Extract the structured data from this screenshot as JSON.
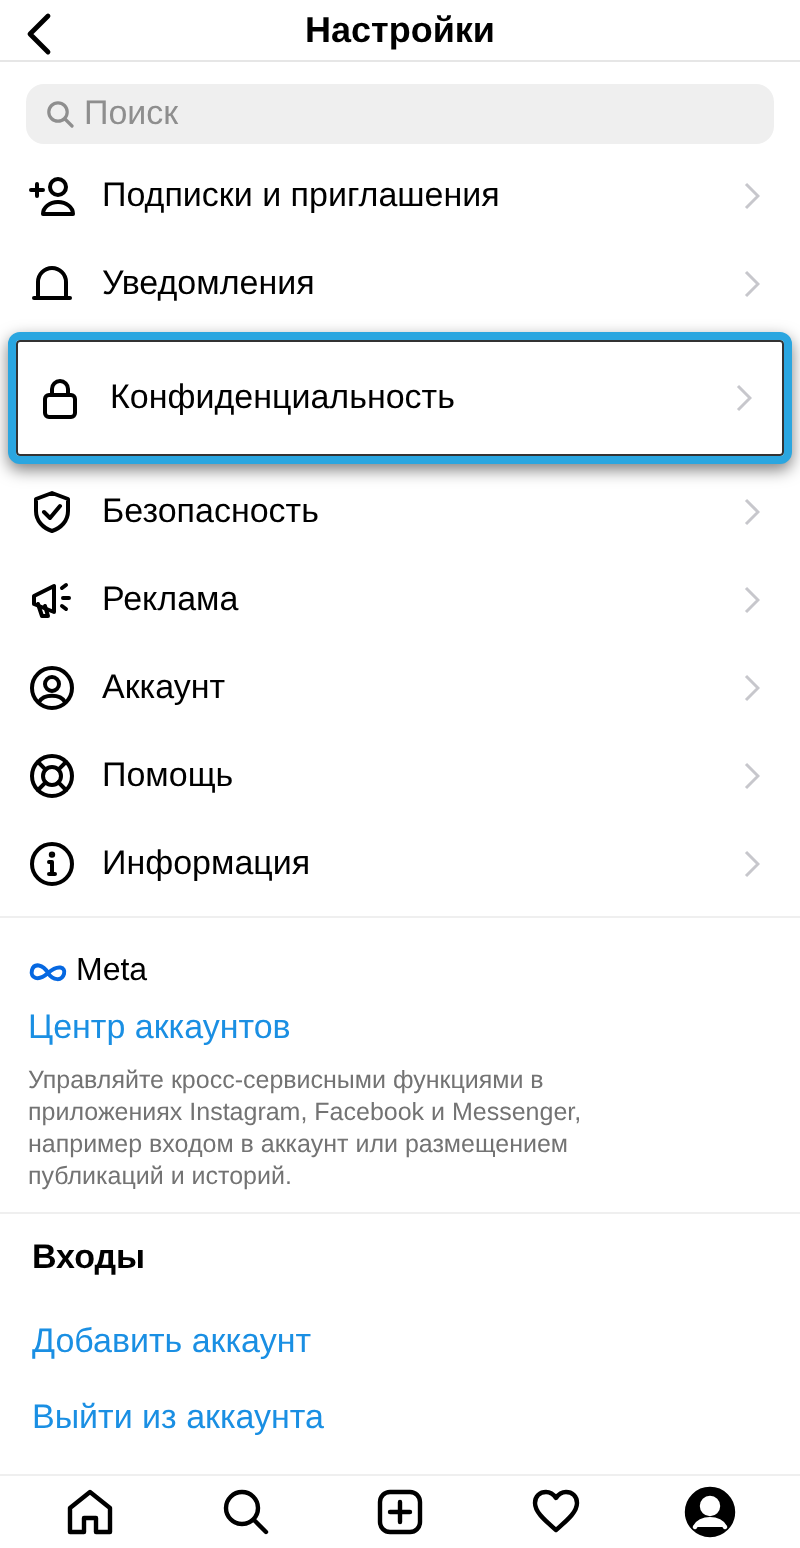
{
  "header": {
    "title": "Настройки"
  },
  "search": {
    "placeholder": "Поиск"
  },
  "settings_items": [
    {
      "label": "Подписки и приглашения",
      "highlighted": false
    },
    {
      "label": "Уведомления",
      "highlighted": false
    },
    {
      "label": "Конфиденциальность",
      "highlighted": true
    },
    {
      "label": "Безопасность",
      "highlighted": false
    },
    {
      "label": "Реклама",
      "highlighted": false
    },
    {
      "label": "Аккаунт",
      "highlighted": false
    },
    {
      "label": "Помощь",
      "highlighted": false
    },
    {
      "label": "Информация",
      "highlighted": false
    }
  ],
  "meta_section": {
    "brand": "Meta",
    "link": "Центр аккаунтов",
    "description": "Управляйте кросс-сервисными функциями в приложениях Instagram, Facebook и Messenger, например входом в аккаунт или размещением публикаций и историй."
  },
  "logins": {
    "title": "Входы",
    "links": [
      "Добавить аккаунт",
      "Выйти из аккаунта"
    ]
  },
  "tab_bar": [
    {
      "selected": false
    },
    {
      "selected": false
    },
    {
      "selected": false
    },
    {
      "selected": false
    },
    {
      "selected": true
    }
  ]
}
